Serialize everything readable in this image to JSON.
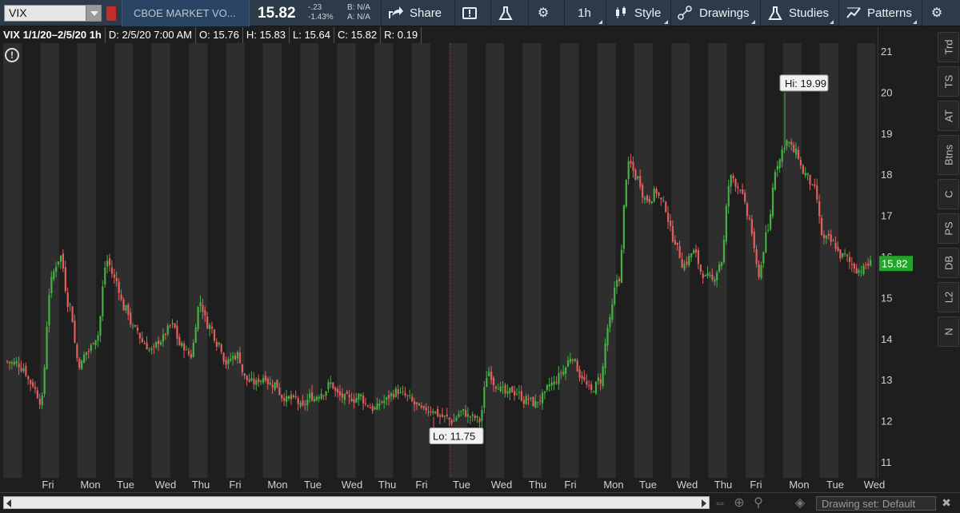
{
  "toolbar": {
    "symbol": "VIX",
    "description": "CBOE MARKET VO...",
    "last_price": "15.82",
    "change_abs": "-.23",
    "change_pct": "-1.43%",
    "bid": "B: N/A",
    "ask": "A: N/A",
    "share_label": "Share",
    "aggregation_label": "1h",
    "style_label": "Style",
    "drawings_label": "Drawings",
    "studies_label": "Studies",
    "patterns_label": "Patterns"
  },
  "info_bar": {
    "title": "VIX 1/1/20–2/5/20 1h",
    "date": "D: 2/5/20 7:00 AM",
    "open": "O: 15.76",
    "high": "H: 15.83",
    "low": "L: 15.64",
    "close": "C: 15.82",
    "range": "R: 0.19"
  },
  "chart_data": {
    "type": "candlestick",
    "symbol": "VIX",
    "interval": "1h",
    "ylim": [
      10.6,
      21.6
    ],
    "y_ticks": [
      11,
      12,
      13,
      14,
      15,
      16,
      17,
      18,
      19,
      20,
      21
    ],
    "x_tick_labels": [
      "Fri",
      "Mon",
      "Tue",
      "Wed",
      "Thu",
      "Fri",
      "Mon",
      "Tue",
      "Wed",
      "Thu",
      "Fri",
      "Tue",
      "Wed",
      "Thu",
      "Fri",
      "Mon",
      "Tue",
      "Wed",
      "Thu",
      "Fri",
      "Mon",
      "Tue",
      "Wed"
    ],
    "current_price_label": "15.82",
    "hi_label": "Hi: 19.99",
    "lo_label": "Lo: 11.75",
    "hi_value": 19.99,
    "lo_value": 11.75,
    "closes": [
      13.4,
      13.3,
      12.9,
      12.5,
      15.4,
      16.0,
      14.8,
      13.4,
      13.7,
      14.1,
      15.9,
      15.4,
      14.7,
      14.2,
      13.9,
      13.7,
      14.0,
      14.3,
      13.8,
      13.6,
      14.9,
      14.3,
      13.9,
      13.4,
      13.6,
      13.0,
      12.9,
      13.1,
      12.9,
      12.6,
      12.5,
      12.3,
      12.6,
      12.7,
      12.9,
      12.6,
      12.5,
      12.6,
      12.4,
      12.3,
      12.5,
      12.7,
      12.6,
      12.4,
      12.2,
      12.3,
      12.1,
      12.0,
      12.2,
      12.1,
      12.0,
      13.2,
      12.9,
      12.6,
      12.7,
      12.5,
      12.4,
      12.6,
      12.9,
      13.2,
      13.6,
      13.1,
      12.7,
      13.0,
      14.4,
      15.5,
      18.2,
      17.9,
      17.4,
      17.6,
      17.2,
      16.4,
      15.8,
      16.1,
      15.6,
      15.4,
      15.9,
      17.9,
      17.7,
      16.9,
      15.6,
      16.6,
      18.3,
      18.8,
      18.5,
      18.0,
      17.6,
      16.4,
      16.3,
      16.0,
      15.8,
      15.7,
      15.82
    ]
  }
}
